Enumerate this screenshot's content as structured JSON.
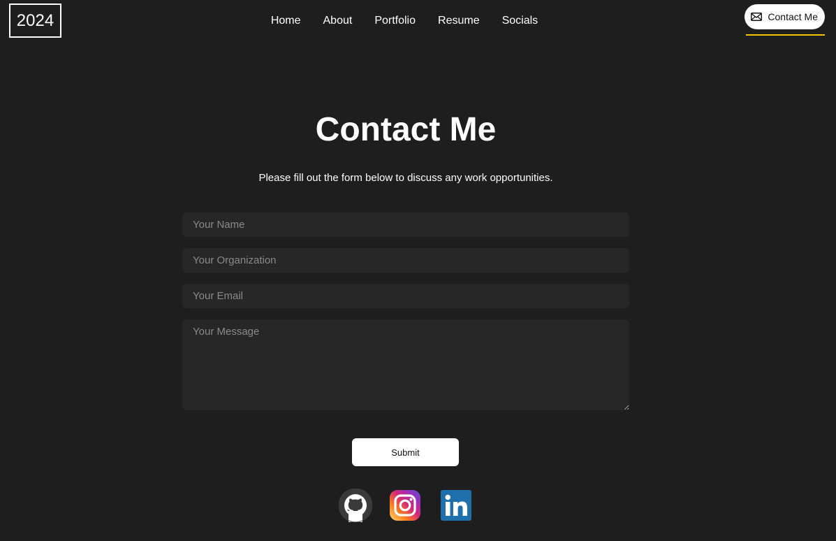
{
  "logo": {
    "text": "2024"
  },
  "nav": {
    "items": [
      {
        "label": "Home"
      },
      {
        "label": "About"
      },
      {
        "label": "Portfolio"
      },
      {
        "label": "Resume"
      },
      {
        "label": "Socials"
      }
    ]
  },
  "header": {
    "contact_button": {
      "label": "Contact Me",
      "icon": "mail-icon"
    },
    "accent_color": "#f5c400"
  },
  "main": {
    "title": "Contact Me",
    "subtitle": "Please fill out the form below to discuss any work opportunities.",
    "form": {
      "name": {
        "placeholder": "Your Name",
        "value": ""
      },
      "organization": {
        "placeholder": "Your Organization",
        "value": ""
      },
      "email": {
        "placeholder": "Your Email",
        "value": ""
      },
      "message": {
        "placeholder": "Your Message",
        "value": ""
      },
      "submit_label": "Submit"
    }
  },
  "socials": [
    {
      "icon": "github-icon"
    },
    {
      "icon": "instagram-icon"
    },
    {
      "icon": "linkedin-icon"
    }
  ],
  "colors": {
    "background": "#1e1e1e",
    "field_background": "#272727",
    "text": "#ffffff"
  }
}
